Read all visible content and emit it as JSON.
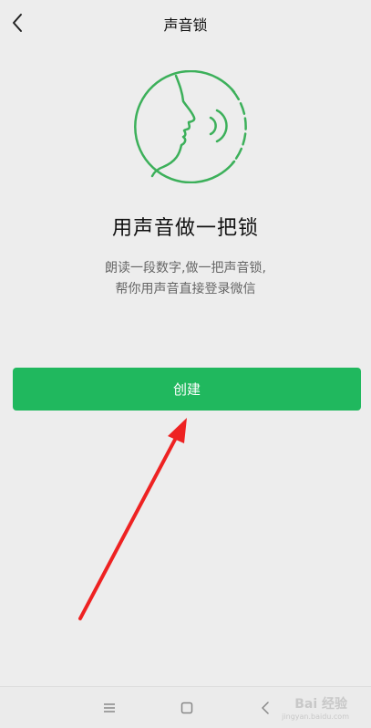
{
  "header": {
    "title": "声音锁",
    "back_icon": "chevron-left-icon"
  },
  "main": {
    "illustration_icon": "voice-face-icon",
    "headline": "用声音做一把锁",
    "description_line1": "朗读一段数字,做一把声音锁,",
    "description_line2": "帮你用声音直接登录微信",
    "create_label": "创建",
    "accent_color": "#20b85e",
    "illustration_color": "#3cb05a"
  },
  "annotation": {
    "arrow_color": "#ee2222"
  },
  "navbar": {
    "menu_icon": "menu-icon",
    "home_icon": "square-home-icon",
    "back_icon": "back-triangle-icon",
    "watermark": "Bai 经验",
    "watermark_sub": "jingyan.baidu.com"
  }
}
